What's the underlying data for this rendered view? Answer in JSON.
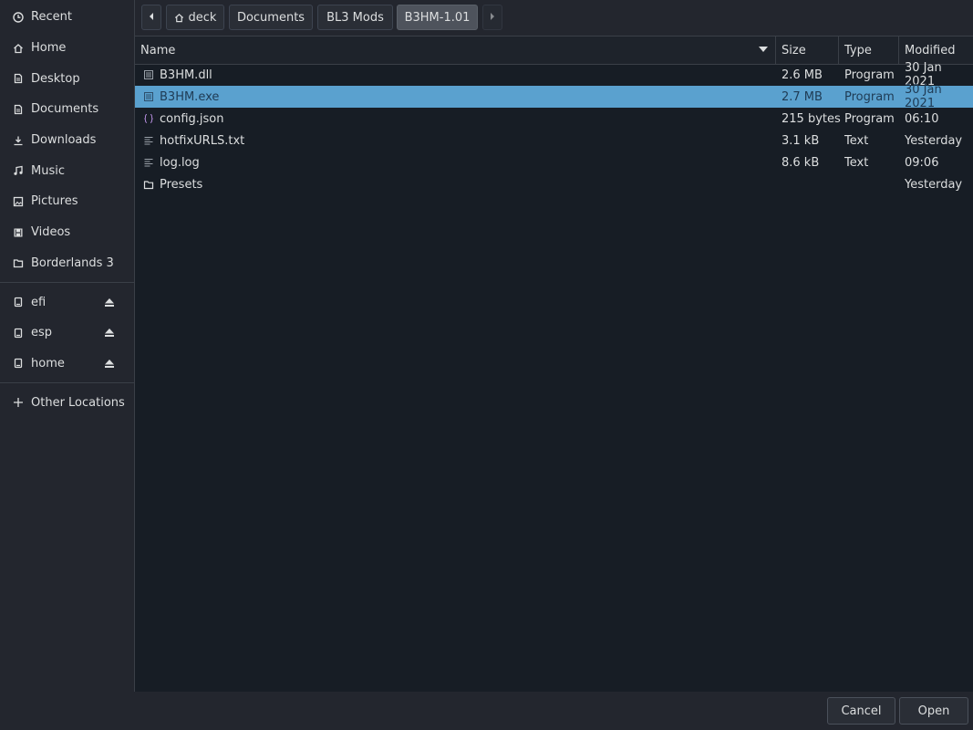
{
  "sidebar": {
    "places": [
      {
        "label": "Recent",
        "icon": "clock-icon"
      },
      {
        "label": "Home",
        "icon": "home-icon"
      },
      {
        "label": "Desktop",
        "icon": "desktop-icon"
      },
      {
        "label": "Documents",
        "icon": "documents-icon"
      },
      {
        "label": "Downloads",
        "icon": "download-icon"
      },
      {
        "label": "Music",
        "icon": "music-icon"
      },
      {
        "label": "Pictures",
        "icon": "pictures-icon"
      },
      {
        "label": "Videos",
        "icon": "videos-icon"
      },
      {
        "label": "Borderlands 3",
        "icon": "folder-icon"
      }
    ],
    "devices": [
      {
        "label": "efi",
        "icon": "drive-icon"
      },
      {
        "label": "esp",
        "icon": "drive-icon"
      },
      {
        "label": "home",
        "icon": "drive-icon"
      }
    ],
    "other": {
      "label": "Other Locations",
      "icon": "plus-icon"
    }
  },
  "path_bar": {
    "crumbs": [
      "deck",
      "Documents",
      "BL3 Mods",
      "B3HM-1.01"
    ],
    "home_icon": "home-icon",
    "back_icon": "chevron-left-icon",
    "forward_icon": "chevron-right-icon"
  },
  "columns": {
    "name": "Name",
    "size": "Size",
    "type": "Type",
    "modified": "Modified"
  },
  "files": [
    {
      "name": "B3HM.dll",
      "size": "2.6 MB",
      "type": "Program",
      "modified": "30 Jan 2021",
      "icon": "binary-file-icon"
    },
    {
      "name": "B3HM.exe",
      "size": "2.7 MB",
      "type": "Program",
      "modified": "30 Jan 2021",
      "icon": "binary-file-icon"
    },
    {
      "name": "config.json",
      "size": "215 bytes",
      "type": "Program",
      "modified": "06:10",
      "icon": "json-file-icon"
    },
    {
      "name": "hotfixURLS.txt",
      "size": "3.1 kB",
      "type": "Text",
      "modified": "Yesterday",
      "icon": "text-file-icon"
    },
    {
      "name": "log.log",
      "size": "8.6 kB",
      "type": "Text",
      "modified": "09:06",
      "icon": "text-file-icon"
    },
    {
      "name": "Presets",
      "size": "",
      "type": "",
      "modified": "Yesterday",
      "icon": "folder-icon"
    }
  ],
  "selected_row": 1,
  "footer": {
    "cancel": "Cancel",
    "open": "Open"
  },
  "colors": {
    "accent": "#5aa1cf",
    "background": "#171d25",
    "panel": "#23262e"
  }
}
